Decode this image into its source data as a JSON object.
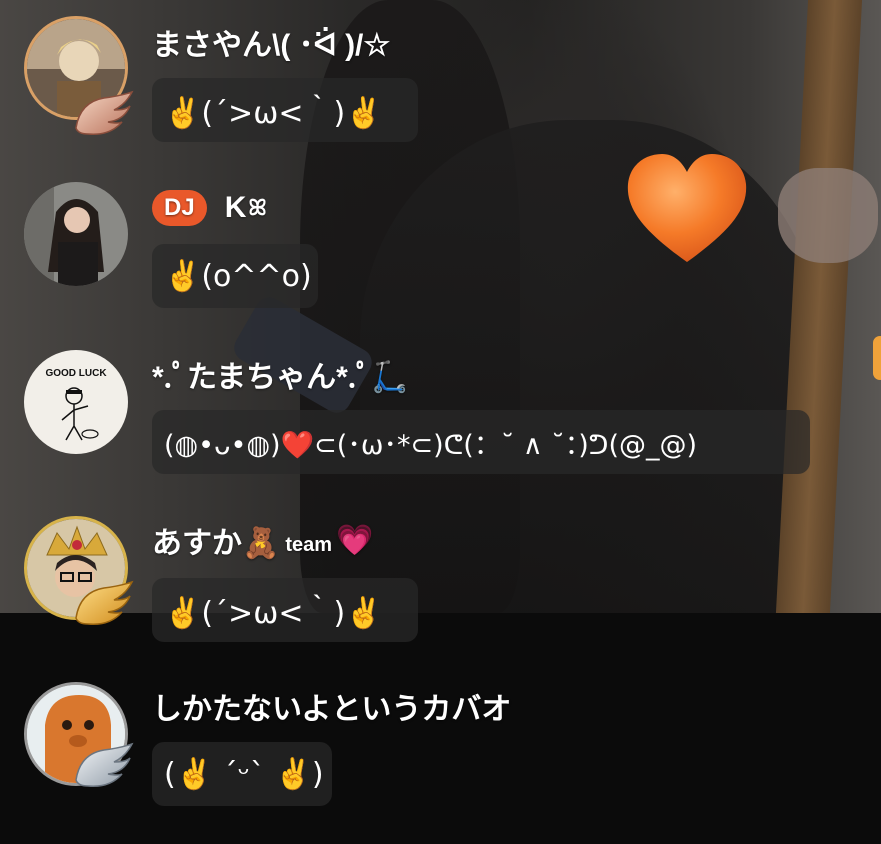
{
  "colors": {
    "dj_badge": "#e9582a",
    "bubble_bg": "rgba(40,40,40,0.72)",
    "heart": "#f07a2a"
  },
  "messages": [
    {
      "name": "まさやん\\( ･ᐛ )/☆",
      "text": "✌️(´>ω<｀)✌️",
      "avatar_icon": "blonde-character-avatar",
      "has_wing_badge": true
    },
    {
      "badge": "DJ",
      "name": "K",
      "name_suffix": "ꕤ",
      "text": "✌️(o^^o)",
      "avatar_icon": "woman-photo-avatar",
      "has_wing_badge": false
    },
    {
      "name": "*.ﾟたまちゃん*.ﾟ🛴",
      "text": "(◍•ᴗ•◍)❤️⊂(･ω･*⊂)ᕦ(：˘ ∧ ˘：)ᕤ(@_@)",
      "avatar_icon": "good-luck-sketch-avatar",
      "avatar_text": "GOOD LUCK",
      "has_wing_badge": false
    },
    {
      "name": "あすか🧸",
      "name_small": "team",
      "name_emoji": "💗",
      "text": "✌️(´>ω<｀)✌️",
      "avatar_icon": "crowned-boy-avatar",
      "has_wing_badge": true
    },
    {
      "name": "しかたないよというカバオ",
      "text": "(✌️ ´ᵕ` ✌️)",
      "avatar_icon": "orange-character-avatar",
      "has_wing_badge": true
    }
  ]
}
